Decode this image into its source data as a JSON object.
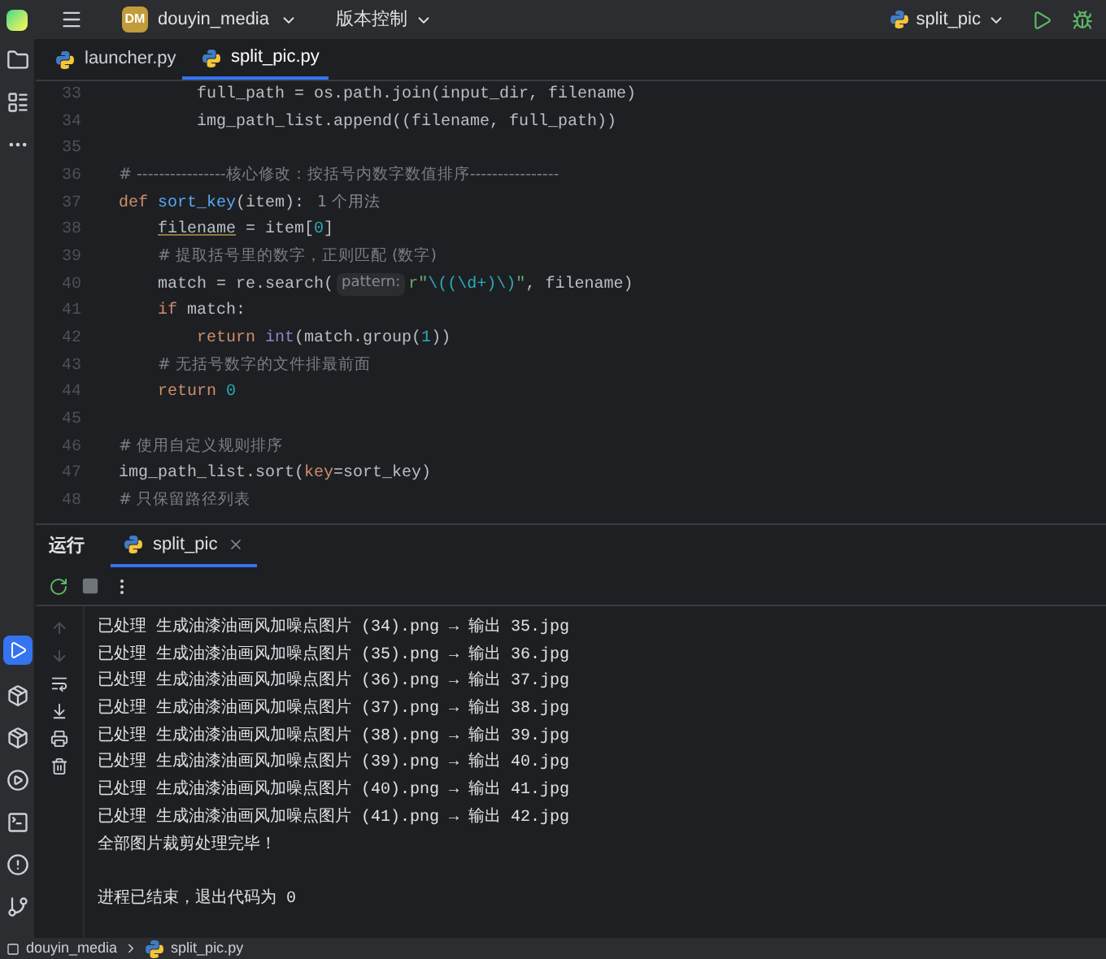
{
  "title_bar": {
    "project_badge": "DM",
    "project": "douyin_media",
    "vcs": "版本控制",
    "run_config": "split_pic"
  },
  "tabs": [
    {
      "label": "launcher.py",
      "selected": false
    },
    {
      "label": "split_pic.py",
      "selected": true
    }
  ],
  "code_lines": [
    {
      "children": [
        {
          "children": [
            {
              "number": "33",
              "tokens": [
                {
                  "t": "full_path = os.path.join(input_dir, filename)",
                  "kind": "plain"
                }
              ]
            },
            {
              "number": "34",
              "tokens": [
                {
                  "t": "img_path_list.append((filename, full_path))",
                  "kind": "plain"
                }
              ]
            }
          ]
        }
      ]
    },
    {
      "number": "35"
    },
    {
      "number": "36",
      "tokens": [
        {
          "t": "# ----------------核心修改：按括号内数字数值排序----------------",
          "kind": "comment"
        }
      ]
    },
    {
      "number": "37",
      "tokens": [
        {
          "t": "def ",
          "kind": "kw"
        },
        {
          "t": "sort_key",
          "kind": "fn"
        },
        {
          "t": "(item):",
          "kind": "plain"
        },
        {
          "t": "1 个用法",
          "kind": "hint"
        }
      ],
      "children": [
        {
          "number": "38",
          "tokens": [
            {
              "t": "filename",
              "kind": "var"
            },
            {
              "t": " = item[",
              "kind": "plain"
            },
            {
              "t": "0",
              "kind": "num"
            },
            {
              "t": "]",
              "kind": "plain"
            }
          ]
        },
        {
          "number": "39",
          "tokens": [
            {
              "t": "# 提取括号里的数字，正则匹配 (数字)",
              "kind": "comment"
            }
          ]
        },
        {
          "number": "40",
          "tokens": [
            {
              "t": "match = re.search(",
              "kind": "plain"
            },
            {
              "t": "pattern:",
              "kind": "inlay"
            },
            {
              "t": "r\"",
              "kind": "str"
            },
            {
              "t": "\\((\\d+)\\)",
              "kind": "regex"
            },
            {
              "t": "\"",
              "kind": "str"
            },
            {
              "t": ", filename)",
              "kind": "plain"
            }
          ]
        },
        {
          "number": "41",
          "tokens": [
            {
              "t": "if ",
              "kind": "kw"
            },
            {
              "t": "match:",
              "kind": "plain"
            }
          ],
          "children": [
            {
              "number": "42",
              "tokens": [
                {
                  "t": "return ",
                  "kind": "kw"
                },
                {
                  "t": "int",
                  "kind": "builtin"
                },
                {
                  "t": "(match.group(",
                  "kind": "plain"
                },
                {
                  "t": "1",
                  "kind": "num"
                },
                {
                  "t": "))",
                  "kind": "plain"
                }
              ]
            }
          ]
        },
        {
          "number": "43",
          "tokens": [
            {
              "t": "# 无括号数字的文件排最前面",
              "kind": "comment"
            }
          ]
        },
        {
          "number": "44",
          "tokens": [
            {
              "t": "return ",
              "kind": "kw"
            },
            {
              "t": "0",
              "kind": "num"
            }
          ]
        }
      ]
    },
    {
      "number": "45"
    },
    {
      "number": "46",
      "tokens": [
        {
          "t": "# 使用自定义规则排序",
          "kind": "comment"
        }
      ]
    },
    {
      "number": "47",
      "tokens": [
        {
          "t": "img_path_list.sort(",
          "kind": "plain"
        },
        {
          "t": "key",
          "kind": "param"
        },
        {
          "t": "=sort_key)",
          "kind": "plain"
        }
      ]
    },
    {
      "number": "48",
      "tokens": [
        {
          "t": "# 只保留路径列表",
          "kind": "comment"
        }
      ]
    }
  ],
  "run_panel": {
    "title": "运行",
    "tabs": [
      {
        "label": "split_pic",
        "selected": true
      }
    ],
    "output": [
      {
        "text": "已处理 生成油漆油画风加噪点图片 (34).png → 输出 35.jpg",
        "gap_before": false
      },
      {
        "text": "已处理 生成油漆油画风加噪点图片 (35).png → 输出 36.jpg",
        "gap_before": false
      },
      {
        "text": "已处理 生成油漆油画风加噪点图片 (36).png → 输出 37.jpg",
        "gap_before": false
      },
      {
        "text": "已处理 生成油漆油画风加噪点图片 (37).png → 输出 38.jpg",
        "gap_before": false
      },
      {
        "text": "已处理 生成油漆油画风加噪点图片 (38).png → 输出 39.jpg",
        "gap_before": false
      },
      {
        "text": "已处理 生成油漆油画风加噪点图片 (39).png → 输出 40.jpg",
        "gap_before": false
      },
      {
        "text": "已处理 生成油漆油画风加噪点图片 (40).png → 输出 41.jpg",
        "gap_before": false
      },
      {
        "text": "已处理 生成油漆油画风加噪点图片 (41).png → 输出 42.jpg",
        "gap_before": false
      },
      {
        "text": "全部图片裁剪处理完毕！",
        "gap_before": false
      },
      {
        "text": "进程已结束，退出代码为 0",
        "gap_before": true
      }
    ]
  },
  "status_bar": {
    "breadcrumbs": [
      "douyin_media",
      "split_pic.py"
    ]
  }
}
